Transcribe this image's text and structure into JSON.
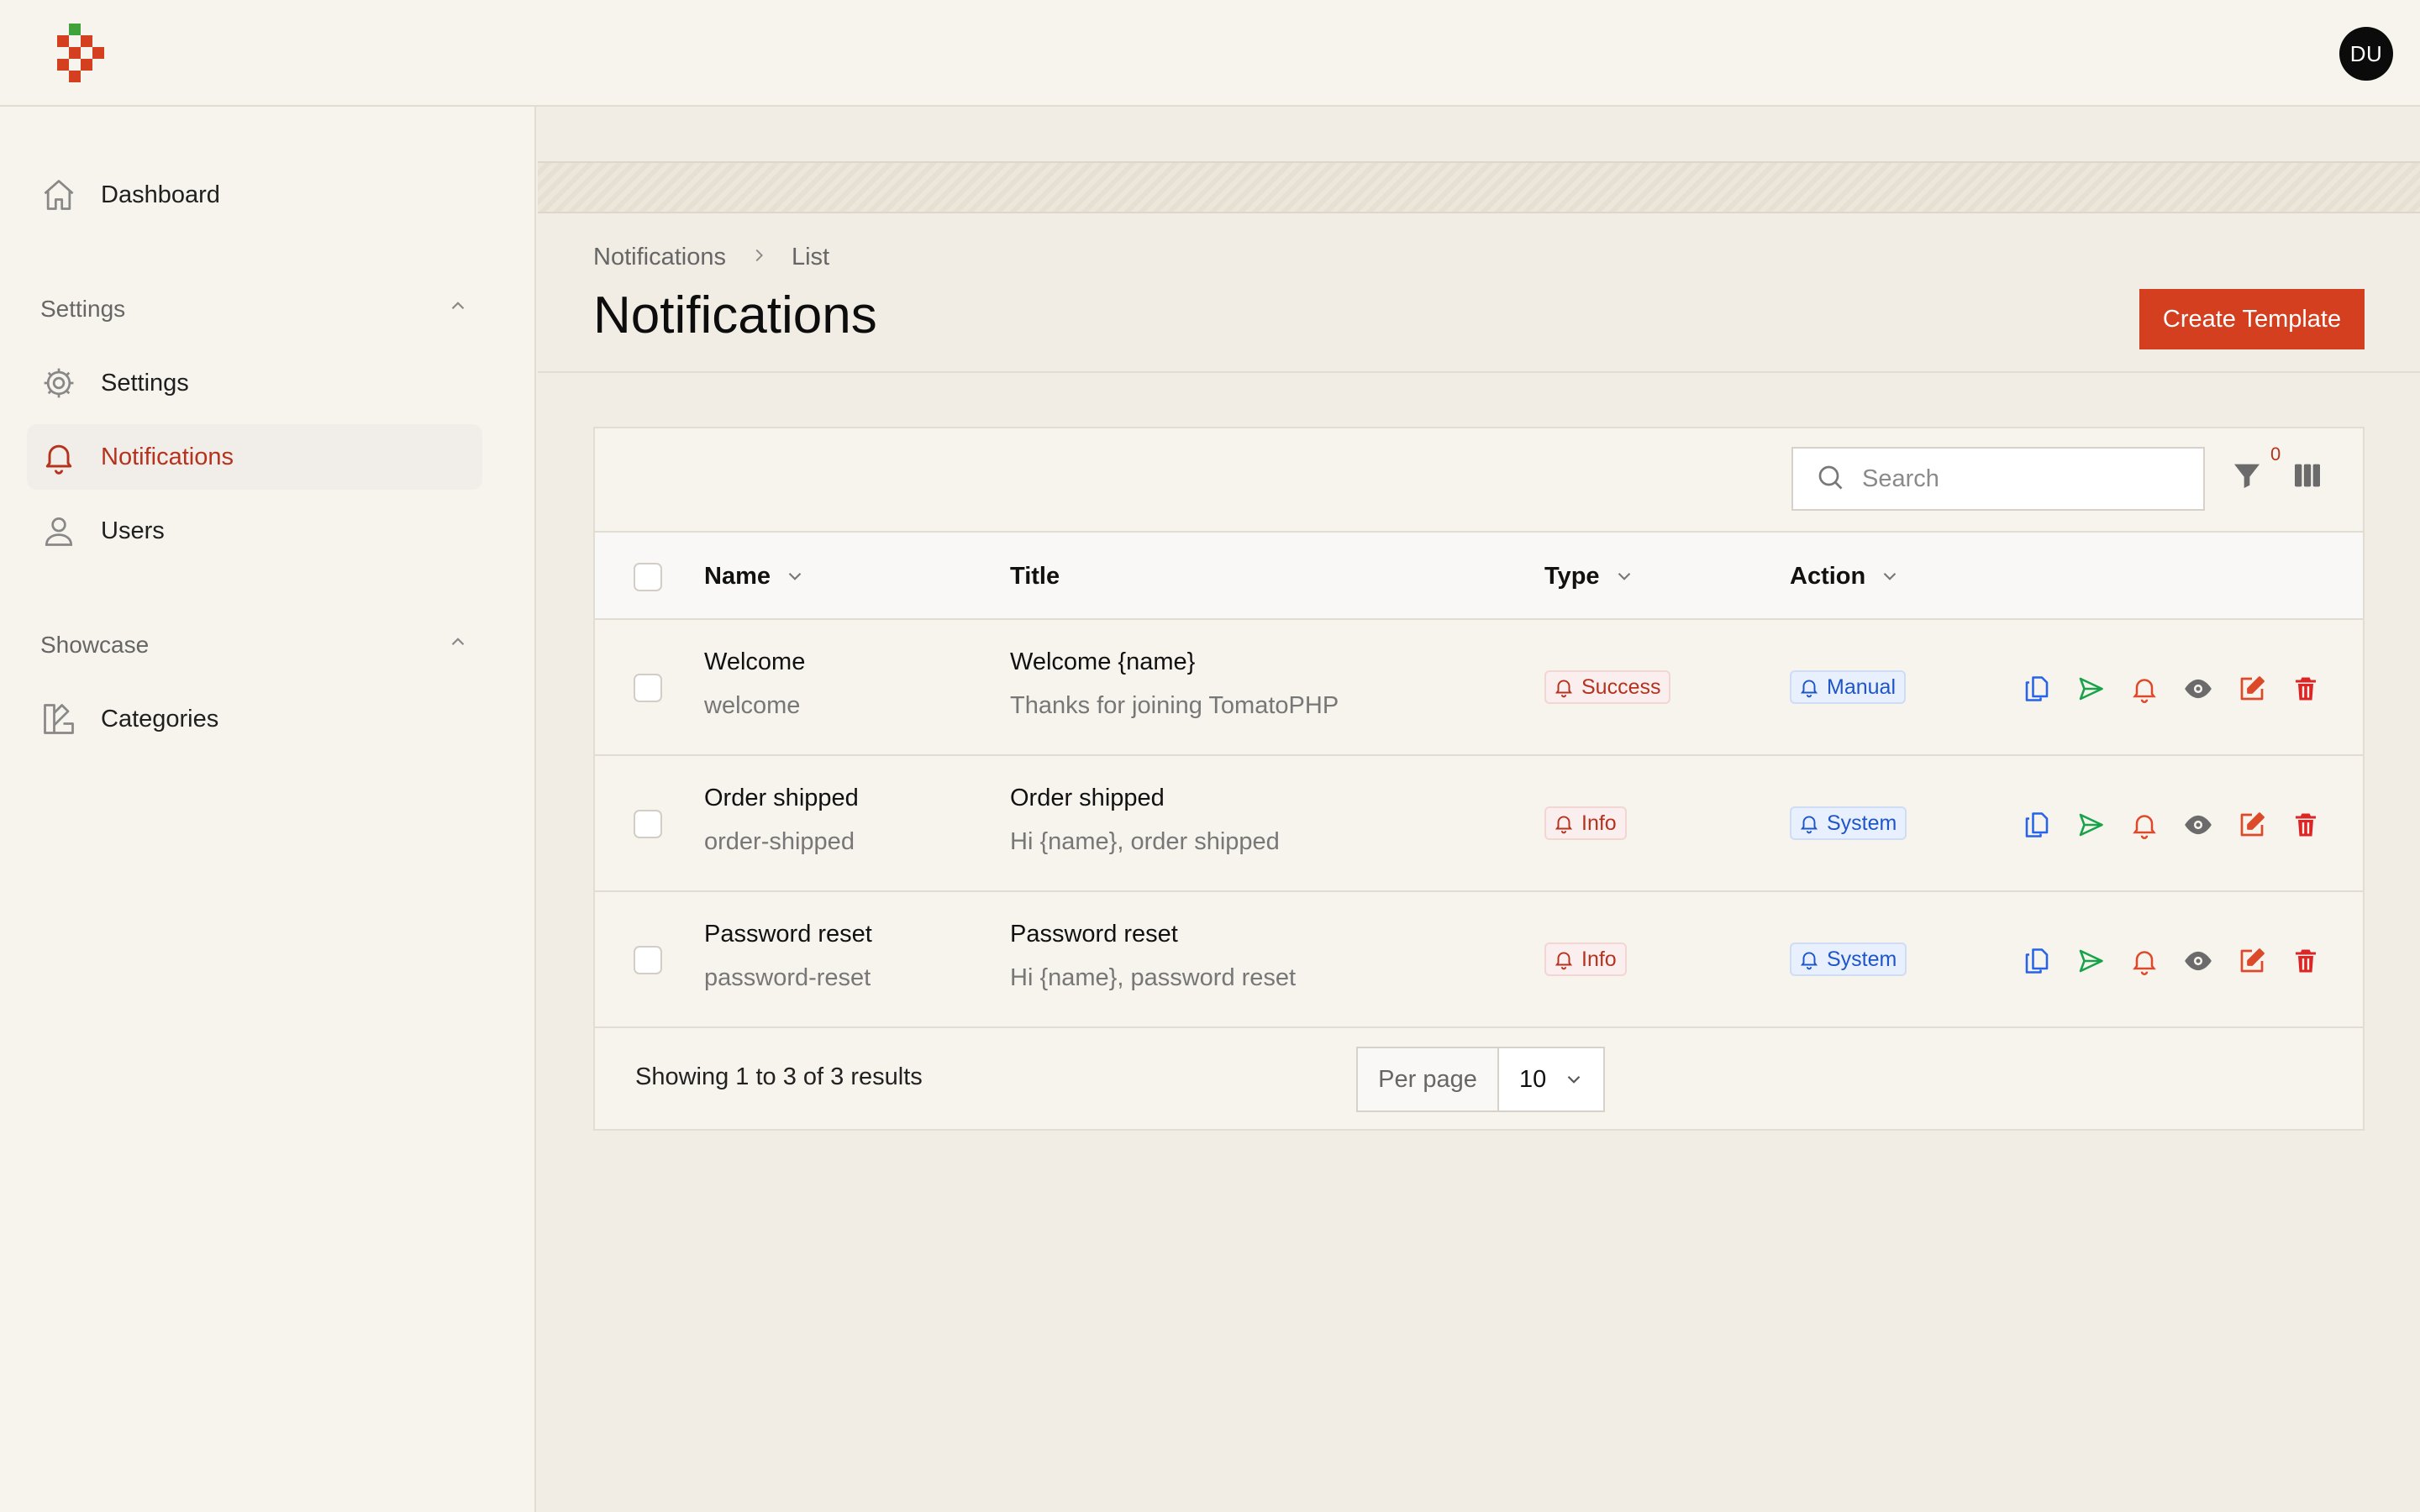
{
  "user": {
    "initials": "DU"
  },
  "sidebar": {
    "dashboard": {
      "label": "Dashboard",
      "icon": "home-icon"
    },
    "groups": [
      {
        "label": "Settings",
        "items": [
          {
            "label": "Settings",
            "icon": "gear-icon"
          },
          {
            "label": "Notifications",
            "icon": "bell-icon",
            "active": true
          },
          {
            "label": "Users",
            "icon": "user-icon"
          }
        ]
      },
      {
        "label": "Showcase",
        "items": [
          {
            "label": "Categories",
            "icon": "categories-icon"
          }
        ]
      }
    ]
  },
  "breadcrumb": {
    "root": "Notifications",
    "current": "List"
  },
  "page": {
    "title": "Notifications",
    "create_button": "Create Template"
  },
  "table": {
    "search_placeholder": "Search",
    "filter_count": "0",
    "columns": {
      "name": "Name",
      "title": "Title",
      "type": "Type",
      "action": "Action"
    },
    "rows": [
      {
        "name": "Welcome",
        "key": "welcome",
        "title": "Welcome {name}",
        "body": "Thanks for joining TomatoPHP",
        "type": "Success",
        "action": "Manual"
      },
      {
        "name": "Order shipped",
        "key": "order-shipped",
        "title": "Order shipped",
        "body": "Hi {name}, order shipped",
        "type": "Info",
        "action": "System"
      },
      {
        "name": "Password reset",
        "key": "password-reset",
        "title": "Password reset",
        "body": "Hi {name}, password reset",
        "type": "Info",
        "action": "System"
      }
    ],
    "footer": {
      "summary": "Showing 1 to 3 of 3 results",
      "per_page_label": "Per page",
      "per_page_value": "10"
    }
  },
  "colors": {
    "accent": "#d33f1f",
    "active_nav": "#b5331e",
    "badge_red": "#b5331e",
    "badge_blue": "#1e56c9",
    "copy_icon": "#2563eb",
    "send_icon": "#16a34a",
    "bell_icon": "#dc4a2a",
    "eye_icon": "#6b6b6b",
    "edit_icon": "#dc4a2a",
    "delete_icon": "#dc2626"
  }
}
